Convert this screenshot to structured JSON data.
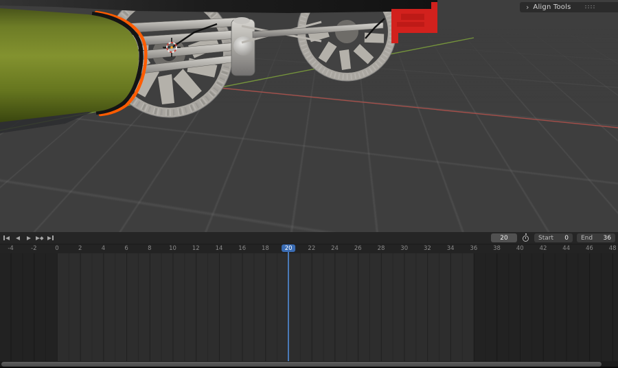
{
  "viewport": {
    "align_panel": {
      "chevron": "›",
      "title": "Align Tools"
    },
    "icons": {
      "align_panel_grip": "drag-grip-dots",
      "playback": [
        "jump-to-start",
        "play-reverse",
        "play-forward",
        "next-keyframe",
        "jump-to-end"
      ],
      "auto_key": "stopwatch"
    },
    "scene_objects": [
      "green-boiler-cylinder",
      "front-spoked-wheel",
      "rear-spoked-wheel",
      "chassis-rods",
      "cylinder-block",
      "coupling-rod",
      "red-flag-bracket",
      "armature-bones",
      "3d-cursor"
    ],
    "colors": {
      "viewport_bg": "#3e3e3e",
      "axis_x_red": "#b0524c",
      "axis_y_green": "#7fa33c",
      "selection_outline_orange": "#ff5c00",
      "boiler_green": "#7d8c2c",
      "flag_red": "#d2211d"
    }
  },
  "timeline": {
    "current_frame": "20",
    "start_label": "Start",
    "start_value": "0",
    "end_label": "End",
    "end_value": "36",
    "frame_range": {
      "start": 0,
      "end": 36
    },
    "ruler_labels": [
      "-4",
      "-2",
      "0",
      "2",
      "4",
      "6",
      "8",
      "10",
      "12",
      "14",
      "16",
      "18",
      "20",
      "22",
      "24",
      "26",
      "28",
      "30",
      "32",
      "34",
      "36",
      "38",
      "40",
      "42",
      "44",
      "46",
      "48"
    ],
    "accent_blue": "#3a6cb4"
  }
}
